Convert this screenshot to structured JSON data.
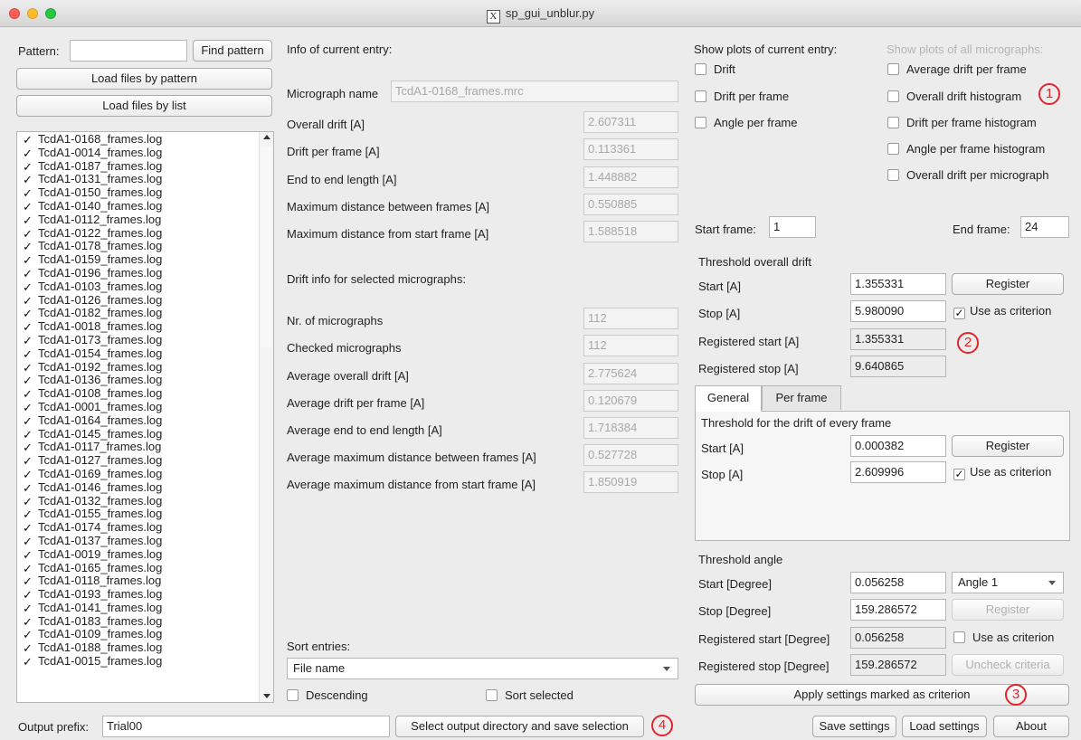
{
  "window": {
    "title": "sp_gui_unblur.py"
  },
  "left": {
    "pattern_label": "Pattern:",
    "pattern_value": "",
    "find_pattern": "Find pattern",
    "load_by_pattern": "Load files by pattern",
    "load_by_list": "Load files by list",
    "files": [
      "TcdA1-0168_frames.log",
      "TcdA1-0014_frames.log",
      "TcdA1-0187_frames.log",
      "TcdA1-0131_frames.log",
      "TcdA1-0150_frames.log",
      "TcdA1-0140_frames.log",
      "TcdA1-0112_frames.log",
      "TcdA1-0122_frames.log",
      "TcdA1-0178_frames.log",
      "TcdA1-0159_frames.log",
      "TcdA1-0196_frames.log",
      "TcdA1-0103_frames.log",
      "TcdA1-0126_frames.log",
      "TcdA1-0182_frames.log",
      "TcdA1-0018_frames.log",
      "TcdA1-0173_frames.log",
      "TcdA1-0154_frames.log",
      "TcdA1-0192_frames.log",
      "TcdA1-0136_frames.log",
      "TcdA1-0108_frames.log",
      "TcdA1-0001_frames.log",
      "TcdA1-0164_frames.log",
      "TcdA1-0145_frames.log",
      "TcdA1-0117_frames.log",
      "TcdA1-0127_frames.log",
      "TcdA1-0169_frames.log",
      "TcdA1-0146_frames.log",
      "TcdA1-0132_frames.log",
      "TcdA1-0155_frames.log",
      "TcdA1-0174_frames.log",
      "TcdA1-0137_frames.log",
      "TcdA1-0019_frames.log",
      "TcdA1-0165_frames.log",
      "TcdA1-0118_frames.log",
      "TcdA1-0193_frames.log",
      "TcdA1-0141_frames.log",
      "TcdA1-0183_frames.log",
      "TcdA1-0109_frames.log",
      "TcdA1-0188_frames.log",
      "TcdA1-0015_frames.log"
    ],
    "check_glyph": "✓",
    "output_prefix_label": "Output prefix:",
    "output_prefix_value": "Trial00",
    "save_selection": "Select output directory and save selection"
  },
  "info": {
    "heading": "Info of current entry:",
    "micrograph_name_label": "Micrograph name",
    "micrograph_name_value": "TcdA1-0168_frames.mrc",
    "rows": [
      {
        "label": "Overall drift [A]",
        "value": "2.607311"
      },
      {
        "label": "Drift per frame [A]",
        "value": "0.113361"
      },
      {
        "label": "End to end length [A]",
        "value": "1.448882"
      },
      {
        "label": "Maximum distance between frames [A]",
        "value": "0.550885"
      },
      {
        "label": "Maximum distance from start frame [A]",
        "value": "1.588518"
      }
    ],
    "selected_heading": "Drift info for selected micrographs:",
    "selected_rows": [
      {
        "label": "Nr. of micrographs",
        "value": "112"
      },
      {
        "label": "Checked micrographs",
        "value": "112"
      },
      {
        "label": "Average overall drift [A]",
        "value": "2.775624"
      },
      {
        "label": "Average drift per frame [A]",
        "value": "0.120679"
      },
      {
        "label": "Average end to end length [A]",
        "value": "1.718384"
      },
      {
        "label": "Average maximum distance between frames [A]",
        "value": "0.527728"
      },
      {
        "label": "Average maximum distance from start frame [A]",
        "value": "1.850919"
      }
    ],
    "sort_label": "Sort entries:",
    "sort_value": "File name",
    "descending": "Descending",
    "sort_selected": "Sort selected"
  },
  "plots": {
    "current_heading": "Show plots of current entry:",
    "current": [
      "Drift",
      "Drift per frame",
      "Angle per frame"
    ],
    "all_heading": "Show plots of all micrographs:",
    "all": [
      "Average drift per frame",
      "Overall drift histogram",
      "Drift per frame histogram",
      "Angle per frame histogram",
      "Overall drift per micrograph"
    ]
  },
  "frames": {
    "start_label": "Start frame:",
    "start_value": "1",
    "end_label": "End frame:",
    "end_value": "24"
  },
  "overall": {
    "heading": "Threshold overall drift",
    "start_label": "Start [A]",
    "start_value": "1.355331",
    "stop_label": "Stop [A]",
    "stop_value": "5.980090",
    "reg_start_label": "Registered start [A]",
    "reg_start_value": "1.355331",
    "reg_stop_label": "Registered stop [A]",
    "reg_stop_value": "9.640865",
    "register": "Register",
    "use_criterion": "Use as criterion"
  },
  "tabs": {
    "general": "General",
    "per_frame": "Per frame",
    "heading": "Threshold for the drift of every frame",
    "start_label": "Start [A]",
    "start_value": "0.000382",
    "stop_label": "Stop [A]",
    "stop_value": "2.609996",
    "register": "Register",
    "use_criterion": "Use as criterion"
  },
  "angle": {
    "heading": "Threshold angle",
    "start_label": "Start [Degree]",
    "start_value": "0.056258",
    "stop_label": "Stop [Degree]",
    "stop_value": "159.286572",
    "reg_start_label": "Registered start [Degree]",
    "reg_start_value": "0.056258",
    "reg_stop_label": "Registered stop [Degree]",
    "reg_stop_value": "159.286572",
    "select_value": "Angle 1",
    "register": "Register",
    "use_criterion": "Use as criterion",
    "uncheck": "Uncheck criteria"
  },
  "bottom": {
    "apply": "Apply settings marked as criterion",
    "save_settings": "Save settings",
    "load_settings": "Load settings",
    "about": "About"
  },
  "callouts": [
    "1",
    "2",
    "3",
    "4"
  ],
  "colors": {
    "accent": "#e3242b",
    "close": "#fc5f57",
    "minimize": "#fdbb2e",
    "maximize": "#2ac840"
  }
}
